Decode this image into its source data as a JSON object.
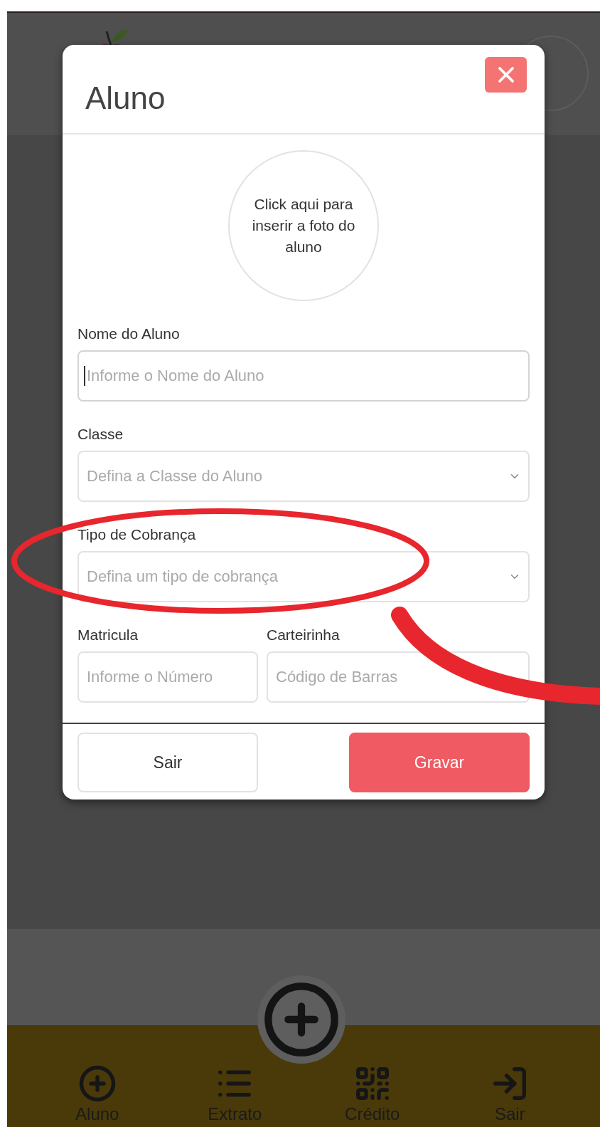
{
  "modal": {
    "title": "Aluno",
    "photo_prompt": "Click aqui para inserir a foto do aluno",
    "fields": [
      {
        "kind": "input",
        "label": "Nome do Aluno",
        "placeholder": "Informe o Nome do Aluno",
        "focused": true
      },
      {
        "kind": "select",
        "label": "Classe",
        "placeholder": "Defina a Classe do Aluno",
        "focused": false
      },
      {
        "kind": "select",
        "label": "Tipo de Cobrança",
        "placeholder": "Defina um tipo de cobrança",
        "focused": false
      }
    ],
    "pair_fields": [
      {
        "kind": "input",
        "label": "Matricula",
        "placeholder": "Informe o Número",
        "focused": false
      },
      {
        "kind": "input",
        "label": "Carteirinha",
        "placeholder": "Código de Barras",
        "focused": false
      }
    ],
    "buttons": [
      {
        "kind": "secondary",
        "label": "Sair"
      },
      {
        "kind": "primary",
        "label": "Gravar"
      }
    ]
  },
  "bottom_nav": {
    "items": [
      {
        "kind": "add",
        "label": "Aluno"
      },
      {
        "kind": "list",
        "label": "Extrato"
      },
      {
        "kind": "qr",
        "label": "Crédito"
      },
      {
        "kind": "logout",
        "label": "Sair"
      }
    ]
  }
}
